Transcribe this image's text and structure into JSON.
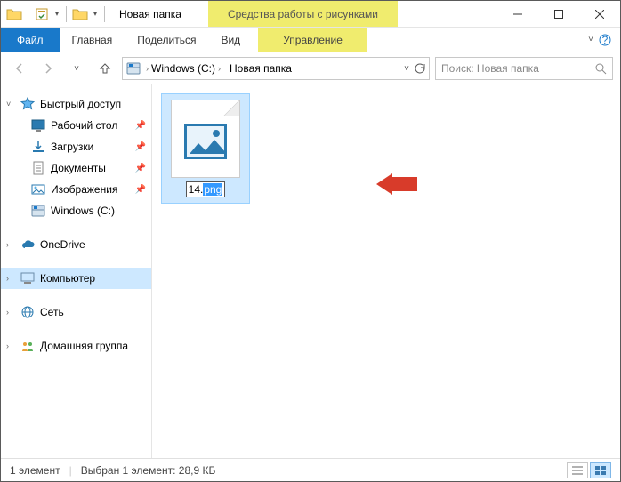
{
  "title": "Новая папка",
  "context_tab_group": "Средства работы с рисунками",
  "ribbon": {
    "file": "Файл",
    "home": "Главная",
    "share": "Поделиться",
    "view": "Вид",
    "manage": "Управление"
  },
  "breadcrumbs": {
    "drive": "Windows (C:)",
    "folder": "Новая папка"
  },
  "search_placeholder": "Поиск: Новая папка",
  "sidebar": {
    "quick_access": "Быстрый доступ",
    "desktop": "Рабочий стол",
    "downloads": "Загрузки",
    "documents": "Документы",
    "pictures": "Изображения",
    "drive": "Windows (C:)",
    "onedrive": "OneDrive",
    "computer": "Компьютер",
    "network": "Сеть",
    "homegroup": "Домашняя группа"
  },
  "file": {
    "name_prefix": "14.",
    "name_selected": "png"
  },
  "status": {
    "count": "1 элемент",
    "selection": "Выбран 1 элемент: 28,9 КБ"
  }
}
